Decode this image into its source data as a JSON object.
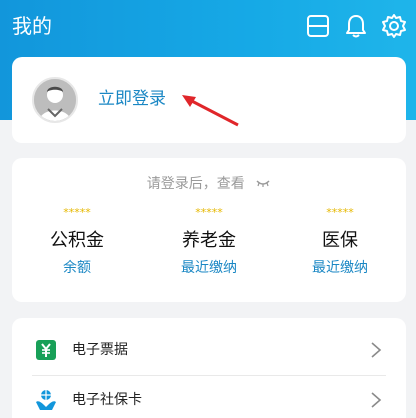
{
  "header": {
    "title": "我的",
    "icons": [
      "scan-icon",
      "bell-icon",
      "gear-icon"
    ]
  },
  "login_card": {
    "link_text": "立即登录",
    "avatar_icon": "default-user-avatar"
  },
  "info_card": {
    "hint": "请登录后，查看",
    "eye_icon": "eye-closed-icon",
    "columns": [
      {
        "masked": "*****",
        "title": "公积金",
        "sub": "余额"
      },
      {
        "masked": "*****",
        "title": "养老金",
        "sub": "最近缴纳"
      },
      {
        "masked": "*****",
        "title": "医保",
        "sub": "最近缴纳"
      }
    ]
  },
  "list": {
    "items": [
      {
        "label": "电子票据",
        "icon": "receipt-yuan-icon"
      },
      {
        "label": "电子社保卡",
        "icon": "social-security-card-icon"
      }
    ]
  },
  "colors": {
    "header_blue": "#1296db",
    "link_blue": "#1a87c4",
    "star_gold": "#e6b800",
    "arrow_red": "#e0262a",
    "receipt_green": "#18a058"
  }
}
